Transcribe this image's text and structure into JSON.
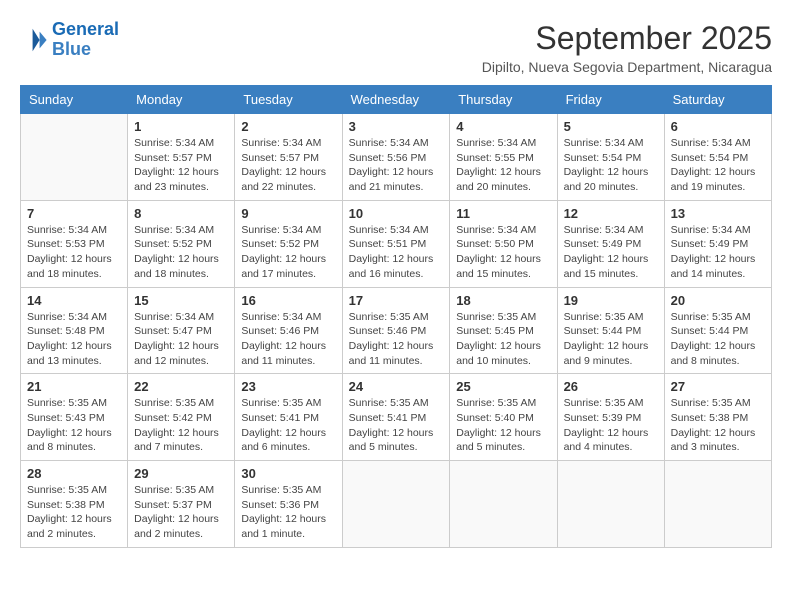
{
  "logo": {
    "line1": "General",
    "line2": "Blue"
  },
  "title": "September 2025",
  "subtitle": "Dipilto, Nueva Segovia Department, Nicaragua",
  "weekdays": [
    "Sunday",
    "Monday",
    "Tuesday",
    "Wednesday",
    "Thursday",
    "Friday",
    "Saturday"
  ],
  "weeks": [
    [
      {
        "day": "",
        "info": ""
      },
      {
        "day": "1",
        "info": "Sunrise: 5:34 AM\nSunset: 5:57 PM\nDaylight: 12 hours\nand 23 minutes."
      },
      {
        "day": "2",
        "info": "Sunrise: 5:34 AM\nSunset: 5:57 PM\nDaylight: 12 hours\nand 22 minutes."
      },
      {
        "day": "3",
        "info": "Sunrise: 5:34 AM\nSunset: 5:56 PM\nDaylight: 12 hours\nand 21 minutes."
      },
      {
        "day": "4",
        "info": "Sunrise: 5:34 AM\nSunset: 5:55 PM\nDaylight: 12 hours\nand 20 minutes."
      },
      {
        "day": "5",
        "info": "Sunrise: 5:34 AM\nSunset: 5:54 PM\nDaylight: 12 hours\nand 20 minutes."
      },
      {
        "day": "6",
        "info": "Sunrise: 5:34 AM\nSunset: 5:54 PM\nDaylight: 12 hours\nand 19 minutes."
      }
    ],
    [
      {
        "day": "7",
        "info": "Sunrise: 5:34 AM\nSunset: 5:53 PM\nDaylight: 12 hours\nand 18 minutes."
      },
      {
        "day": "8",
        "info": "Sunrise: 5:34 AM\nSunset: 5:52 PM\nDaylight: 12 hours\nand 18 minutes."
      },
      {
        "day": "9",
        "info": "Sunrise: 5:34 AM\nSunset: 5:52 PM\nDaylight: 12 hours\nand 17 minutes."
      },
      {
        "day": "10",
        "info": "Sunrise: 5:34 AM\nSunset: 5:51 PM\nDaylight: 12 hours\nand 16 minutes."
      },
      {
        "day": "11",
        "info": "Sunrise: 5:34 AM\nSunset: 5:50 PM\nDaylight: 12 hours\nand 15 minutes."
      },
      {
        "day": "12",
        "info": "Sunrise: 5:34 AM\nSunset: 5:49 PM\nDaylight: 12 hours\nand 15 minutes."
      },
      {
        "day": "13",
        "info": "Sunrise: 5:34 AM\nSunset: 5:49 PM\nDaylight: 12 hours\nand 14 minutes."
      }
    ],
    [
      {
        "day": "14",
        "info": "Sunrise: 5:34 AM\nSunset: 5:48 PM\nDaylight: 12 hours\nand 13 minutes."
      },
      {
        "day": "15",
        "info": "Sunrise: 5:34 AM\nSunset: 5:47 PM\nDaylight: 12 hours\nand 12 minutes."
      },
      {
        "day": "16",
        "info": "Sunrise: 5:34 AM\nSunset: 5:46 PM\nDaylight: 12 hours\nand 11 minutes."
      },
      {
        "day": "17",
        "info": "Sunrise: 5:35 AM\nSunset: 5:46 PM\nDaylight: 12 hours\nand 11 minutes."
      },
      {
        "day": "18",
        "info": "Sunrise: 5:35 AM\nSunset: 5:45 PM\nDaylight: 12 hours\nand 10 minutes."
      },
      {
        "day": "19",
        "info": "Sunrise: 5:35 AM\nSunset: 5:44 PM\nDaylight: 12 hours\nand 9 minutes."
      },
      {
        "day": "20",
        "info": "Sunrise: 5:35 AM\nSunset: 5:44 PM\nDaylight: 12 hours\nand 8 minutes."
      }
    ],
    [
      {
        "day": "21",
        "info": "Sunrise: 5:35 AM\nSunset: 5:43 PM\nDaylight: 12 hours\nand 8 minutes."
      },
      {
        "day": "22",
        "info": "Sunrise: 5:35 AM\nSunset: 5:42 PM\nDaylight: 12 hours\nand 7 minutes."
      },
      {
        "day": "23",
        "info": "Sunrise: 5:35 AM\nSunset: 5:41 PM\nDaylight: 12 hours\nand 6 minutes."
      },
      {
        "day": "24",
        "info": "Sunrise: 5:35 AM\nSunset: 5:41 PM\nDaylight: 12 hours\nand 5 minutes."
      },
      {
        "day": "25",
        "info": "Sunrise: 5:35 AM\nSunset: 5:40 PM\nDaylight: 12 hours\nand 5 minutes."
      },
      {
        "day": "26",
        "info": "Sunrise: 5:35 AM\nSunset: 5:39 PM\nDaylight: 12 hours\nand 4 minutes."
      },
      {
        "day": "27",
        "info": "Sunrise: 5:35 AM\nSunset: 5:38 PM\nDaylight: 12 hours\nand 3 minutes."
      }
    ],
    [
      {
        "day": "28",
        "info": "Sunrise: 5:35 AM\nSunset: 5:38 PM\nDaylight: 12 hours\nand 2 minutes."
      },
      {
        "day": "29",
        "info": "Sunrise: 5:35 AM\nSunset: 5:37 PM\nDaylight: 12 hours\nand 2 minutes."
      },
      {
        "day": "30",
        "info": "Sunrise: 5:35 AM\nSunset: 5:36 PM\nDaylight: 12 hours\nand 1 minute."
      },
      {
        "day": "",
        "info": ""
      },
      {
        "day": "",
        "info": ""
      },
      {
        "day": "",
        "info": ""
      },
      {
        "day": "",
        "info": ""
      }
    ]
  ]
}
